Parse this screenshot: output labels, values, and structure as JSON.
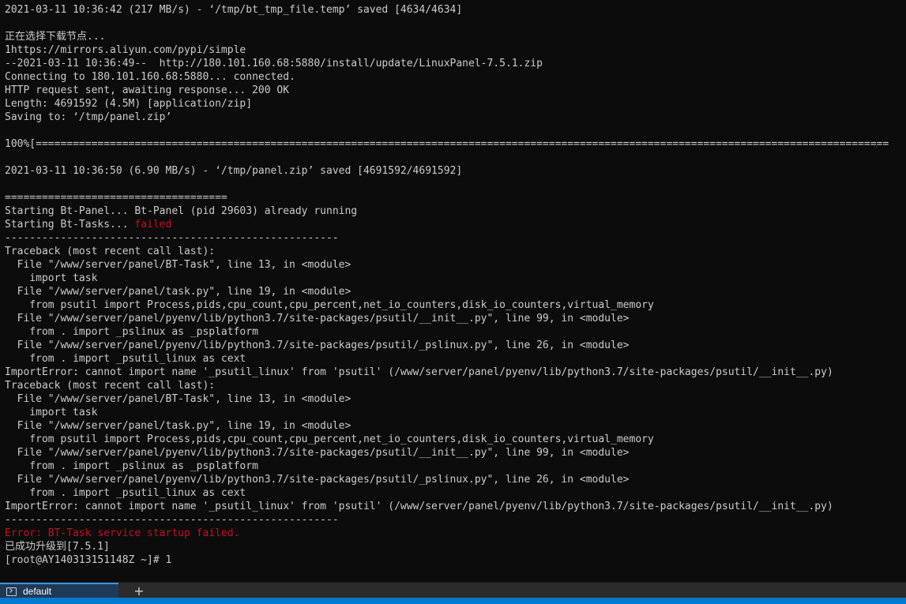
{
  "terminal": {
    "lines": [
      {
        "segments": [
          {
            "text": "2021-03-11 10:36:42 (217 MB/s) - ‘/tmp/bt_tmp_file.temp’ saved [4634/4634]"
          }
        ]
      },
      {
        "segments": [
          {
            "text": ""
          }
        ]
      },
      {
        "segments": [
          {
            "text": "正在选择下载节点..."
          }
        ]
      },
      {
        "segments": [
          {
            "text": "1https://mirrors.aliyun.com/pypi/simple"
          }
        ]
      },
      {
        "segments": [
          {
            "text": "--2021-03-11 10:36:49--  http://180.101.160.68:5880/install/update/LinuxPanel-7.5.1.zip"
          }
        ]
      },
      {
        "segments": [
          {
            "text": "Connecting to 180.101.160.68:5880... connected."
          }
        ]
      },
      {
        "segments": [
          {
            "text": "HTTP request sent, awaiting response... 200 OK"
          }
        ]
      },
      {
        "segments": [
          {
            "text": "Length: 4691592 (4.5M) [application/zip]"
          }
        ]
      },
      {
        "segments": [
          {
            "text": "Saving to: ‘/tmp/panel.zip’"
          }
        ]
      },
      {
        "segments": [
          {
            "text": ""
          }
        ]
      },
      {
        "segments": [
          {
            "text": "100%[=========================================================================================================================================="
          }
        ]
      },
      {
        "segments": [
          {
            "text": ""
          }
        ]
      },
      {
        "segments": [
          {
            "text": "2021-03-11 10:36:50 (6.90 MB/s) - ‘/tmp/panel.zip’ saved [4691592/4691592]"
          }
        ]
      },
      {
        "segments": [
          {
            "text": ""
          }
        ]
      },
      {
        "segments": [
          {
            "text": "===================================="
          }
        ]
      },
      {
        "segments": [
          {
            "text": "Starting Bt-Panel... Bt-Panel (pid 29603) already running"
          }
        ]
      },
      {
        "segments": [
          {
            "text": "Starting Bt-Tasks... "
          },
          {
            "text": "failed",
            "color": "red"
          }
        ]
      },
      {
        "segments": [
          {
            "text": "------------------------------------------------------"
          }
        ]
      },
      {
        "segments": [
          {
            "text": "Traceback (most recent call last):"
          }
        ]
      },
      {
        "segments": [
          {
            "text": "  File \"/www/server/panel/BT-Task\", line 13, in <module>"
          }
        ]
      },
      {
        "segments": [
          {
            "text": "    import task"
          }
        ]
      },
      {
        "segments": [
          {
            "text": "  File \"/www/server/panel/task.py\", line 19, in <module>"
          }
        ]
      },
      {
        "segments": [
          {
            "text": "    from psutil import Process,pids,cpu_count,cpu_percent,net_io_counters,disk_io_counters,virtual_memory"
          }
        ]
      },
      {
        "segments": [
          {
            "text": "  File \"/www/server/panel/pyenv/lib/python3.7/site-packages/psutil/__init__.py\", line 99, in <module>"
          }
        ]
      },
      {
        "segments": [
          {
            "text": "    from . import _pslinux as _psplatform"
          }
        ]
      },
      {
        "segments": [
          {
            "text": "  File \"/www/server/panel/pyenv/lib/python3.7/site-packages/psutil/_pslinux.py\", line 26, in <module>"
          }
        ]
      },
      {
        "segments": [
          {
            "text": "    from . import _psutil_linux as cext"
          }
        ]
      },
      {
        "segments": [
          {
            "text": "ImportError: cannot import name '_psutil_linux' from 'psutil' (/www/server/panel/pyenv/lib/python3.7/site-packages/psutil/__init__.py)"
          }
        ]
      },
      {
        "segments": [
          {
            "text": "Traceback (most recent call last):"
          }
        ]
      },
      {
        "segments": [
          {
            "text": "  File \"/www/server/panel/BT-Task\", line 13, in <module>"
          }
        ]
      },
      {
        "segments": [
          {
            "text": "    import task"
          }
        ]
      },
      {
        "segments": [
          {
            "text": "  File \"/www/server/panel/task.py\", line 19, in <module>"
          }
        ]
      },
      {
        "segments": [
          {
            "text": "    from psutil import Process,pids,cpu_count,cpu_percent,net_io_counters,disk_io_counters,virtual_memory"
          }
        ]
      },
      {
        "segments": [
          {
            "text": "  File \"/www/server/panel/pyenv/lib/python3.7/site-packages/psutil/__init__.py\", line 99, in <module>"
          }
        ]
      },
      {
        "segments": [
          {
            "text": "    from . import _pslinux as _psplatform"
          }
        ]
      },
      {
        "segments": [
          {
            "text": "  File \"/www/server/panel/pyenv/lib/python3.7/site-packages/psutil/_pslinux.py\", line 26, in <module>"
          }
        ]
      },
      {
        "segments": [
          {
            "text": "    from . import _psutil_linux as cext"
          }
        ]
      },
      {
        "segments": [
          {
            "text": "ImportError: cannot import name '_psutil_linux' from 'psutil' (/www/server/panel/pyenv/lib/python3.7/site-packages/psutil/__init__.py)"
          }
        ]
      },
      {
        "segments": [
          {
            "text": "------------------------------------------------------"
          }
        ]
      },
      {
        "segments": [
          {
            "text": "Error: BT-Task service startup failed.",
            "color": "red"
          }
        ]
      },
      {
        "segments": [
          {
            "text": "已成功升级到[7.5.1]"
          }
        ]
      },
      {
        "segments": [
          {
            "text": "[root@AY140313151148Z ~]# 1"
          }
        ]
      }
    ]
  },
  "tabbar": {
    "tab_label": "default",
    "new_tab_label": "+",
    "tab_icon": "terminal-icon"
  },
  "colors": {
    "background": "#0c0c0c",
    "foreground": "#cccccc",
    "error_red": "#c50f1f",
    "tab_active": "#1f3a57",
    "statusbar": "#007acc"
  }
}
